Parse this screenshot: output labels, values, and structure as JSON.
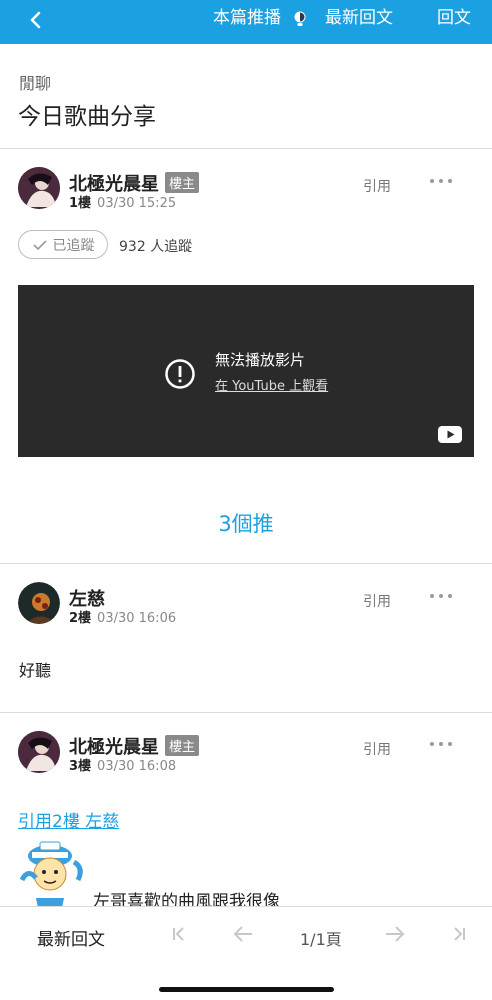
{
  "topbar": {
    "push_label": "本篇推播",
    "latest_label": "最新回文",
    "reply_label": "回文",
    "bg_color": "#1ba1e2"
  },
  "board": "閒聊",
  "title": "今日歌曲分享",
  "posts": [
    {
      "author": "北極光晨星",
      "badge": "樓主",
      "floor": "1樓",
      "time": "03/30 15:25",
      "quote": "引用",
      "tracked_label": "已追蹤",
      "track_count": "932 人追蹤",
      "video": {
        "message": "無法播放影片",
        "link": "在 YouTube 上觀看"
      },
      "push_count": "3個推"
    },
    {
      "author": "左慈",
      "floor": "2樓",
      "time": "03/30 16:06",
      "quote": "引用",
      "text": "好聽"
    },
    {
      "author": "北極光晨星",
      "badge": "樓主",
      "floor": "3樓",
      "time": "03/30 16:08",
      "quote": "引用",
      "quote_link": "引用2樓 左慈",
      "text": "左哥喜歡的曲風跟我很像"
    }
  ],
  "bottombar": {
    "latest_label": "最新回文",
    "page": "1/1頁"
  },
  "icons": {
    "back": "chevron-left-icon",
    "bulb": "lightbulb-icon",
    "more": "ellipsis-icon",
    "check": "check-icon",
    "alert": "alert-circle-icon",
    "youtube": "youtube-icon",
    "first": "first-page-icon",
    "prev": "arrow-left-icon",
    "next": "arrow-right-icon",
    "last": "last-page-icon"
  }
}
